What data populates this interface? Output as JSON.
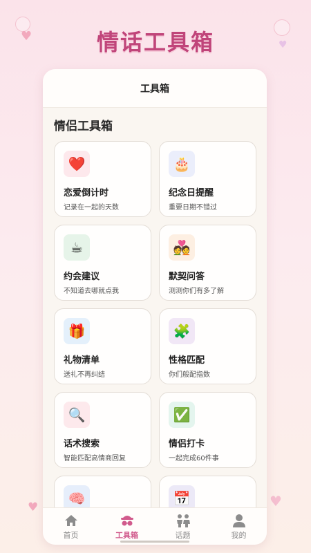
{
  "banner": {
    "title": "情话工具箱"
  },
  "header": {
    "title": "工具箱"
  },
  "section": {
    "title": "情侣工具箱"
  },
  "tools": [
    {
      "title": "恋爱倒计时",
      "subtitle": "记录在一起的天数",
      "icon": "heart-icon",
      "emoji": "❤️",
      "bg": "#fde8ec"
    },
    {
      "title": "纪念日提醒",
      "subtitle": "重要日期不错过",
      "icon": "cake-icon",
      "emoji": "🎂",
      "bg": "#ebeefb"
    },
    {
      "title": "约会建议",
      "subtitle": "不知道去哪就点我",
      "icon": "coffee-icon",
      "emoji": "☕",
      "bg": "#e6f4e9"
    },
    {
      "title": "默契问答",
      "subtitle": "测测你们有多了解",
      "icon": "couple-icon",
      "emoji": "💑",
      "bg": "#fdefe2"
    },
    {
      "title": "礼物清单",
      "subtitle": "送礼不再纠结",
      "icon": "gift-icon",
      "emoji": "🎁",
      "bg": "#e4f0fb"
    },
    {
      "title": "性格匹配",
      "subtitle": "你们般配指数",
      "icon": "puzzle-icon",
      "emoji": "🧩",
      "bg": "#f1e7f6"
    },
    {
      "title": "话术搜索",
      "subtitle": "智能匹配高情商回复",
      "icon": "magnifier-icon",
      "emoji": "🔍",
      "bg": "#fde9ec"
    },
    {
      "title": "情侣打卡",
      "subtitle": "一起完成60件事",
      "icon": "checkbox-icon",
      "emoji": "✅",
      "bg": "#e4f5ee"
    },
    {
      "title": "",
      "subtitle": "",
      "icon": "brain-icon",
      "emoji": "🧠",
      "bg": "#e6eefb"
    },
    {
      "title": "",
      "subtitle": "",
      "icon": "calendar-icon",
      "emoji": "📅",
      "bg": "#ece9f7"
    }
  ],
  "tabbar": {
    "items": [
      {
        "label": "首页",
        "icon": "home-icon"
      },
      {
        "label": "工具箱",
        "icon": "toolbox-icon"
      },
      {
        "label": "话题",
        "icon": "people-icon"
      },
      {
        "label": "我的",
        "icon": "user-icon"
      }
    ],
    "active": "工具箱"
  },
  "colors": {
    "accent": "#d15a8c",
    "banner": "#c0457a"
  }
}
